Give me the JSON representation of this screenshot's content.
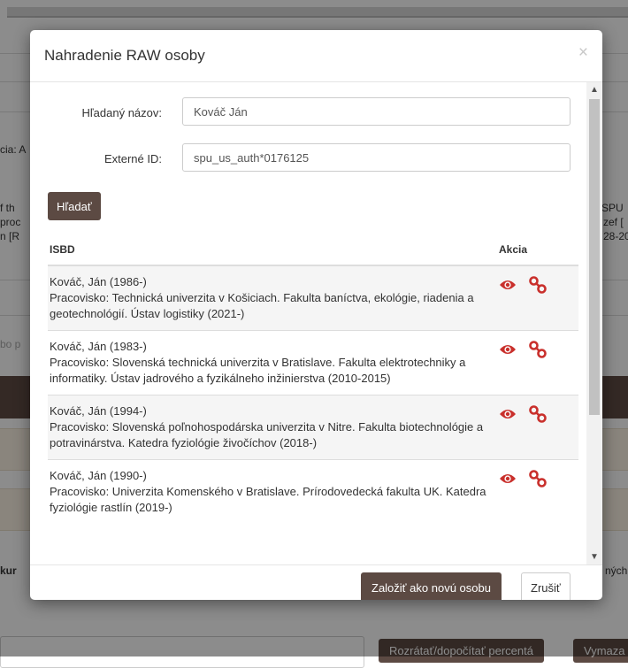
{
  "background": {
    "frag_left_1": "cia: A",
    "frag_left_2": "f th",
    "frag_left_3": "proc",
    "frag_left_4": "n [R",
    "frag_left_5": "bo p",
    "frag_left_6": "kur",
    "frag_right_1": "SPU",
    "frag_right_2": "zef [",
    "frag_right_3": "28-20",
    "frag_right_4": "ných",
    "btn_recount": "Rozrátať/dopočítať percentá",
    "btn_delete": "Vymaza"
  },
  "modal": {
    "title": "Nahradenie RAW osoby",
    "close_symbol": "×",
    "form": {
      "name_label": "Hľadaný názov:",
      "name_value": "Kováč Ján",
      "extid_label": "Externé ID:",
      "extid_value": "spu_us_auth*0176125"
    },
    "search_button": "Hľadať",
    "table": {
      "headers": [
        "ISBD",
        "Akcia"
      ],
      "rows": [
        {
          "name": "Kováč, Ján (1986-)",
          "detail": "Pracovisko: Technická univerzita v Košiciach. Fakulta baníctva, ekológie, riadenia a geotechnológií. Ústav logistiky (2021-)"
        },
        {
          "name": "Kováč, Ján (1983-)",
          "detail": "Pracovisko: Slovenská technická univerzita v Bratislave. Fakulta elektrotechniky a informatiky. Ústav jadrového a fyzikálneho inžinierstva (2010-2015)"
        },
        {
          "name": "Kováč, Ján (1994-)",
          "detail": "Pracovisko: Slovenská poľnohospodárska univerzita v Nitre. Fakulta biotechnológie a potravinárstva. Katedra fyziológie živočíchov (2018-)"
        },
        {
          "name": "Kováč, Ján (1990-)",
          "detail": "Pracovisko: Univerzita Komenského v Bratislave. Prírodovedecká fakulta UK. Katedra fyziológie rastlín (2019-)"
        }
      ]
    },
    "icons": {
      "view": "eye-icon",
      "link": "link-icon"
    },
    "footer": {
      "create_button": "Založiť ako novú osobu",
      "cancel_button": "Zrušiť"
    }
  },
  "colors": {
    "primary": "#5c4a43",
    "icon_red": "#c9302c",
    "overlay": "rgba(0,0,0,0.45)"
  }
}
